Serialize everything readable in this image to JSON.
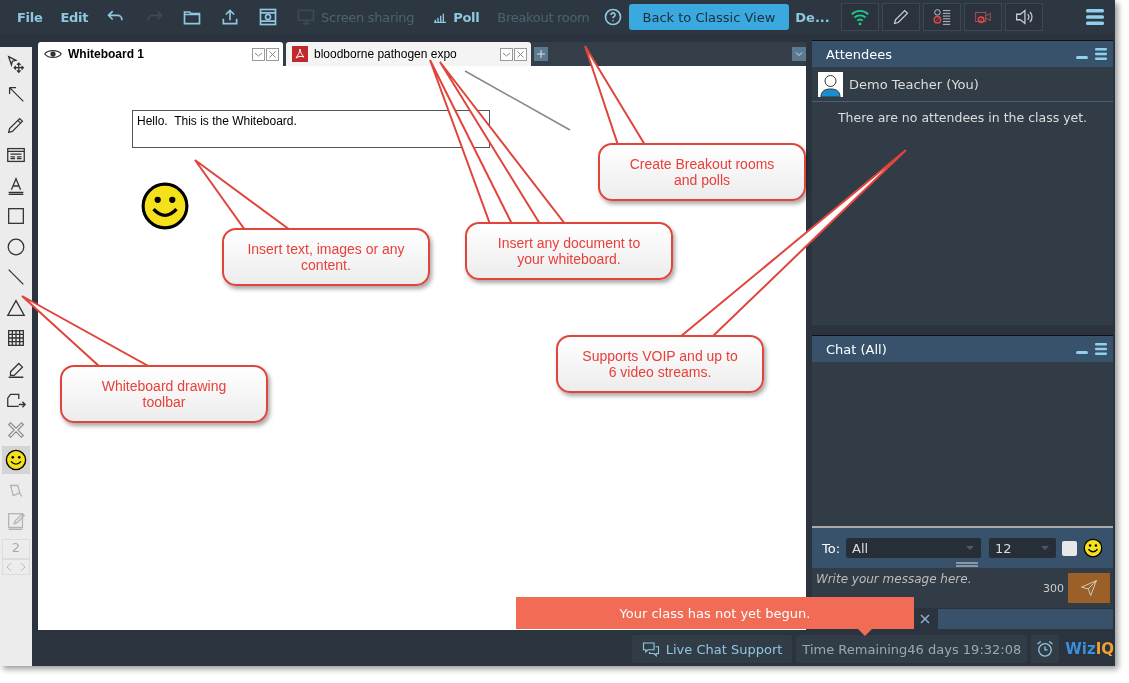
{
  "menu": [
    {
      "kind": "text",
      "label": "File",
      "disabled": false
    },
    {
      "kind": "text",
      "label": "Edit",
      "disabled": false
    },
    {
      "kind": "undo",
      "disabled": false
    },
    {
      "kind": "redo",
      "disabled": true
    },
    {
      "kind": "folder",
      "disabled": false
    },
    {
      "kind": "upload",
      "disabled": false
    },
    {
      "kind": "media",
      "disabled": false
    },
    {
      "kind": "screen",
      "label": "Screen sharing",
      "disabled": true
    },
    {
      "kind": "poll",
      "label": "Poll",
      "disabled": false
    },
    {
      "kind": "text",
      "label": "Breakout room",
      "disabled": true
    },
    {
      "kind": "help",
      "disabled": false
    }
  ],
  "classic_button": "Back to Classic View",
  "user_short": "De...",
  "status_icons": [
    {
      "kind": "wifi"
    },
    {
      "kind": "pencil"
    },
    {
      "kind": "attendance"
    },
    {
      "kind": "camera-off"
    },
    {
      "kind": "speaker"
    }
  ],
  "tools": [
    {
      "kind": "move",
      "selected": false,
      "disabled": false
    },
    {
      "kind": "arrow",
      "selected": false,
      "disabled": false
    },
    {
      "kind": "pencil",
      "selected": false,
      "disabled": false
    },
    {
      "kind": "textbox",
      "selected": false,
      "disabled": false
    },
    {
      "kind": "text",
      "selected": false,
      "disabled": false
    },
    {
      "kind": "rect",
      "selected": false,
      "disabled": false
    },
    {
      "kind": "circle",
      "selected": false,
      "disabled": false
    },
    {
      "kind": "line",
      "selected": false,
      "disabled": false
    },
    {
      "kind": "triangle",
      "selected": false,
      "disabled": false
    },
    {
      "kind": "table",
      "selected": false,
      "disabled": false
    },
    {
      "kind": "eraser",
      "selected": false,
      "disabled": false
    },
    {
      "kind": "insert",
      "selected": false,
      "disabled": false
    },
    {
      "kind": "delete",
      "selected": false,
      "disabled": false
    },
    {
      "kind": "smiley",
      "selected": true,
      "disabled": false
    },
    {
      "kind": "fill",
      "selected": false,
      "disabled": true
    },
    {
      "kind": "edit",
      "selected": false,
      "disabled": true
    }
  ],
  "page_number": "2",
  "tabs": [
    {
      "kind": "whiteboard",
      "label": "Whiteboard 1",
      "selected": true
    },
    {
      "kind": "pdf",
      "label": "bloodborne pathogen expo",
      "selected": false
    }
  ],
  "whiteboard": {
    "text": "Hello.  This is the Whiteboard."
  },
  "attendees": {
    "title": "Attendees",
    "me": "Demo Teacher (You)",
    "empty_message": "There are no attendees in the class yet."
  },
  "chat": {
    "title": "Chat (All)",
    "to_label": "To:",
    "recipient": "All",
    "font_size": "12",
    "bold": false,
    "placeholder": "Write your message here.",
    "counter": "300"
  },
  "notice": "Your class has not yet begun.",
  "bottom": {
    "support": "Live Chat Support",
    "time_label": "Time Remaining",
    "time_value": "46 days 19:32:08",
    "logo_part_1": "Wiz",
    "logo_part_2": "IQ"
  },
  "callouts": [
    {
      "text": "Create Breakout rooms and polls"
    },
    {
      "text": "Insert text, images or any content."
    },
    {
      "text": "Insert any document to your whiteboard."
    },
    {
      "text": "Supports VOIP and up to 6 video streams."
    },
    {
      "text": "Whiteboard drawing toolbar"
    }
  ]
}
